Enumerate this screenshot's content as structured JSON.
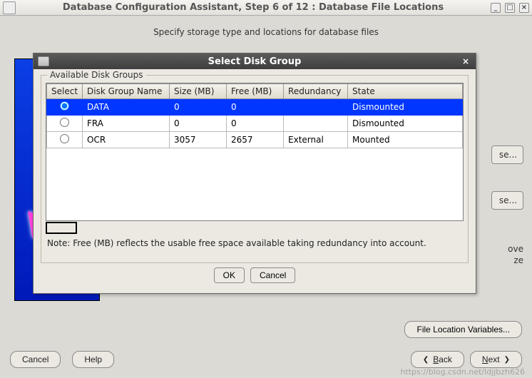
{
  "parent": {
    "title": "Database Configuration Assistant, Step 6 of 12 : Database File Locations",
    "hint": "Specify storage type and locations for database files",
    "browse_partial": "se...",
    "move_partial_1": "ove",
    "move_partial_2": "ze",
    "flv_button": "File Location Variables...",
    "cancel": "Cancel",
    "help": "Help",
    "back_u": "B",
    "back": "ack",
    "next_u": "N",
    "next": "ext"
  },
  "modal": {
    "title": "Select Disk Group",
    "legend": "Available Disk Groups",
    "headers": {
      "select": "Select",
      "name": "Disk Group Name",
      "size": "Size (MB)",
      "free": "Free (MB)",
      "redundancy": "Redundancy",
      "state": "State"
    },
    "rows": [
      {
        "name": "DATA",
        "size": "0",
        "free": "0",
        "redundancy": "",
        "state": "Dismounted",
        "selected": true
      },
      {
        "name": "FRA",
        "size": "0",
        "free": "0",
        "redundancy": "",
        "state": "Dismounted",
        "selected": false
      },
      {
        "name": "OCR",
        "size": "3057",
        "free": "2657",
        "redundancy": "External",
        "state": "Mounted",
        "selected": false
      }
    ],
    "note": "Note:  Free (MB) reflects the usable free space available taking redundancy into account.",
    "ok": "OK",
    "cancel": "Cancel"
  },
  "watermark": "https://blog.csdn.net/ldjjbzh626"
}
